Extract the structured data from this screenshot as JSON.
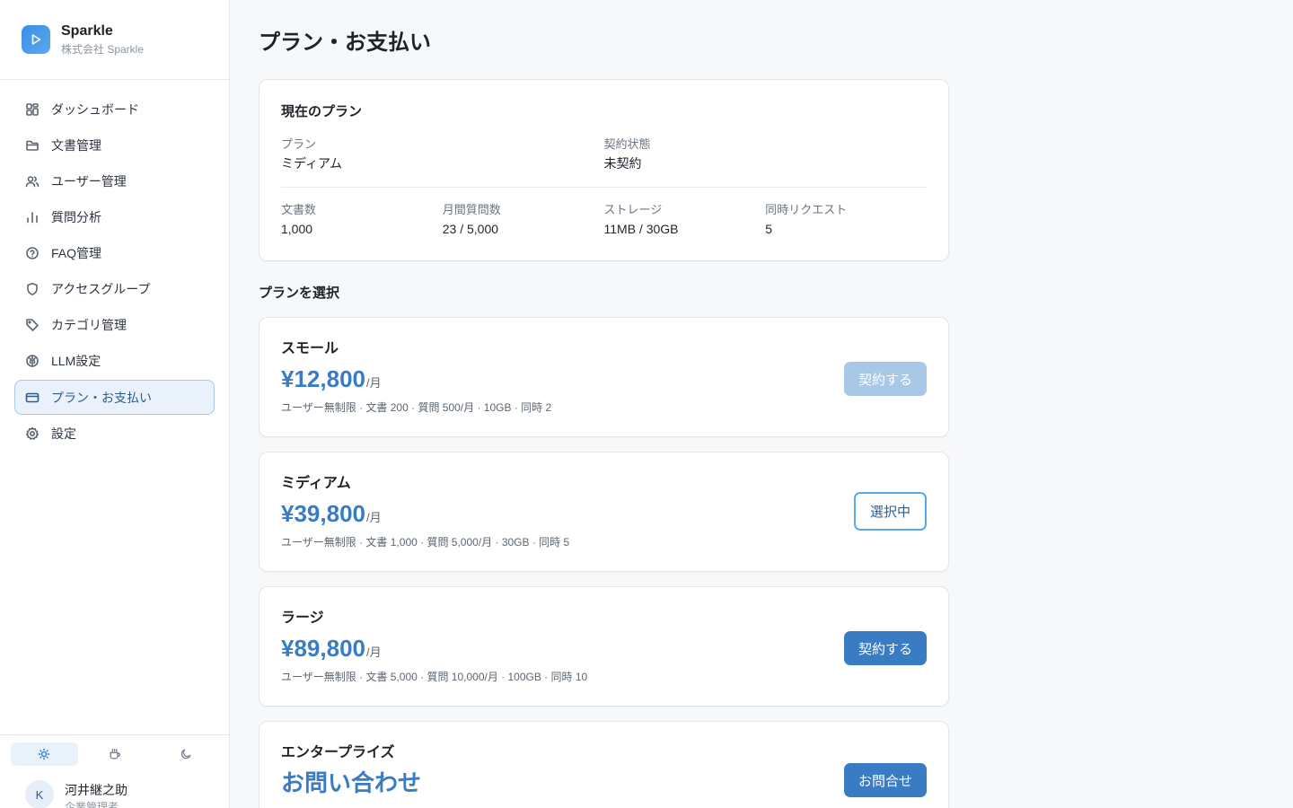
{
  "brand": {
    "name": "Sparkle",
    "company": "株式会社 Sparkle"
  },
  "sidebar": {
    "items": [
      {
        "label": "ダッシュボード",
        "icon": "grid-icon"
      },
      {
        "label": "文書管理",
        "icon": "folder-icon"
      },
      {
        "label": "ユーザー管理",
        "icon": "users-icon"
      },
      {
        "label": "質問分析",
        "icon": "bar-chart-icon"
      },
      {
        "label": "FAQ管理",
        "icon": "help-circle-icon"
      },
      {
        "label": "アクセスグループ",
        "icon": "shield-icon"
      },
      {
        "label": "カテゴリ管理",
        "icon": "tag-icon"
      },
      {
        "label": "LLM設定",
        "icon": "brain-icon"
      },
      {
        "label": "プラン・お支払い",
        "icon": "credit-card-icon",
        "active": true
      },
      {
        "label": "設定",
        "icon": "gear-icon"
      }
    ],
    "theme": {
      "options": [
        "light",
        "coffee",
        "dark"
      ],
      "selected": "light"
    },
    "user": {
      "initial": "K",
      "name": "河井継之助",
      "role": "企業管理者"
    }
  },
  "page": {
    "title": "プラン・お支払い"
  },
  "current_plan": {
    "heading": "現在のプラン",
    "plan_label": "プラン",
    "plan_value": "ミディアム",
    "status_label": "契約状態",
    "status_value": "未契約",
    "stats": [
      {
        "label": "文書数",
        "value": "1,000"
      },
      {
        "label": "月間質問数",
        "value": "23 / 5,000"
      },
      {
        "label": "ストレージ",
        "value": "11MB / 30GB"
      },
      {
        "label": "同時リクエスト",
        "value": "5"
      }
    ]
  },
  "select_heading": "プランを選択",
  "plans": [
    {
      "name": "スモール",
      "price": "¥12,800",
      "unit": "/月",
      "features": "ユーザー無制限 · 文書 200 · 質問 500/月 · 10GB · 同時 2",
      "button": "契約する",
      "button_state": "disabled"
    },
    {
      "name": "ミディアム",
      "price": "¥39,800",
      "unit": "/月",
      "features": "ユーザー無制限 · 文書 1,000 · 質問 5,000/月 · 30GB · 同時 5",
      "button": "選択中",
      "button_state": "current"
    },
    {
      "name": "ラージ",
      "price": "¥89,800",
      "unit": "/月",
      "features": "ユーザー無制限 · 文書 5,000 · 質問 10,000/月 · 100GB · 同時 10",
      "button": "契約する",
      "button_state": "primary"
    },
    {
      "name": "エンタープライズ",
      "price": "お問い合わせ",
      "unit": "",
      "features": "",
      "button": "お問合せ",
      "button_state": "primary"
    }
  ],
  "colors": {
    "accent": "#3a7cc4",
    "active_bg": "#e9f2fb",
    "active_border": "#a7c9ec"
  }
}
